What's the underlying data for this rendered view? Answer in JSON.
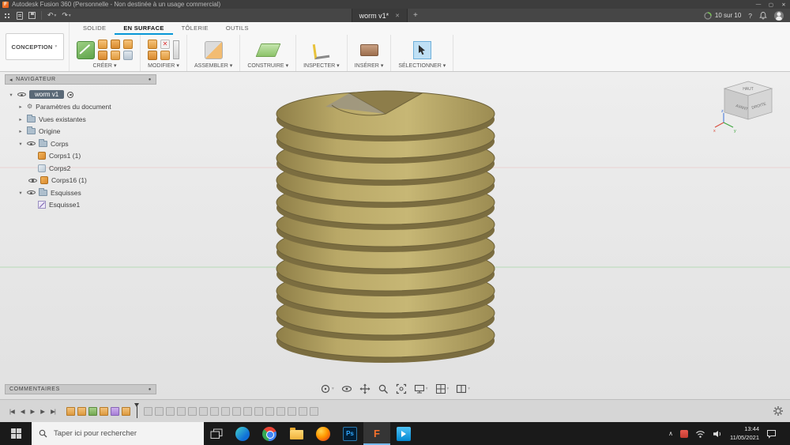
{
  "colors": {
    "accent": "#0696d7",
    "model": "#b3a266",
    "taskbar_active": "#76b9ed"
  },
  "icons": {
    "app": "F",
    "minimize": "—",
    "maximize": "▢",
    "close": "✕",
    "dropdown": "▾",
    "tri_right": "▸",
    "tri_down": "▾",
    "undo": "↶",
    "redo": "↷",
    "add": "+",
    "help": "?",
    "collapse": "◂",
    "dot": "●",
    "gear": "⚙",
    "skip_start": "|◀",
    "step_back": "◀",
    "play": "▶",
    "step_fwd": "▶",
    "skip_end": "▶|",
    "chevron_up": "∧",
    "play_tri": "▶"
  },
  "title_bar": {
    "title": "Autodesk Fusion 360 (Personnelle - Non destinée à un usage commercial)"
  },
  "quick_access": {
    "document_tab": "worm v1*",
    "job_status": "10 sur 10"
  },
  "ribbon": {
    "workspace": "CONCEPTION",
    "tabs": [
      {
        "label": "SOLIDE"
      },
      {
        "label": "EN SURFACE",
        "active": true
      },
      {
        "label": "TÔLERIE"
      },
      {
        "label": "OUTILS"
      }
    ],
    "groups": [
      {
        "label": "CRÉER"
      },
      {
        "label": "MODIFIER"
      },
      {
        "label": "ASSEMBLER"
      },
      {
        "label": "CONSTRUIRE"
      },
      {
        "label": "INSPECTER"
      },
      {
        "label": "INSÉRER"
      },
      {
        "label": "SÉLECTIONNER"
      }
    ]
  },
  "navigator": {
    "header": "NAVIGATEUR",
    "document": "worm v1",
    "items": [
      {
        "label": "Paramètres du document"
      },
      {
        "label": "Vues existantes"
      },
      {
        "label": "Origine"
      },
      {
        "label": "Corps"
      },
      {
        "label": "Corps1 (1)"
      },
      {
        "label": "Corps2"
      },
      {
        "label": "Corps16 (1)"
      },
      {
        "label": "Esquisses"
      },
      {
        "label": "Esquisse1"
      }
    ]
  },
  "viewcube": {
    "top": "HAUT",
    "front": "AVANT",
    "right": "DROITE",
    "axis_x": "x",
    "axis_y": "y",
    "axis_z": "z"
  },
  "comments": {
    "header": "COMMENTAIRES"
  },
  "taskbar": {
    "search_placeholder": "Taper ici pour rechercher",
    "photoshop": "Ps",
    "fusion": "F",
    "time": "13:44",
    "date": "11/05/2021"
  }
}
